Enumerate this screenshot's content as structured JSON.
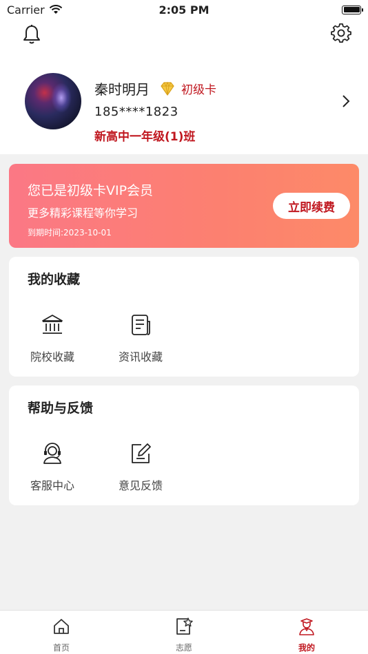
{
  "status_bar": {
    "carrier": "Carrier",
    "time": "2:05 PM"
  },
  "profile": {
    "name": "秦时明月",
    "card_level": "初级卡",
    "phone": "185****1823",
    "class_name": "新高中一年级(1)班"
  },
  "vip": {
    "title": "您已是初级卡VIP会员",
    "subtitle": "更多精彩课程等你学习",
    "expiry": "到期时间:2023-10-01",
    "renew_label": "立即续费"
  },
  "favorites": {
    "title": "我的收藏",
    "items": [
      {
        "label": "院校收藏",
        "icon": "building-icon"
      },
      {
        "label": "资讯收藏",
        "icon": "document-icon"
      }
    ]
  },
  "help": {
    "title": "帮助与反馈",
    "items": [
      {
        "label": "客服中心",
        "icon": "headset-icon"
      },
      {
        "label": "意见反馈",
        "icon": "edit-icon"
      }
    ]
  },
  "tabs": [
    {
      "label": "首页",
      "icon": "home-icon",
      "active": false
    },
    {
      "label": "志愿",
      "icon": "star-doc-icon",
      "active": false
    },
    {
      "label": "我的",
      "icon": "user-icon",
      "active": true
    }
  ],
  "colors": {
    "accent": "#c0171f",
    "vip_gradient_start": "#fb7885",
    "vip_gradient_end": "#fd8a68",
    "background": "#f1f1f1"
  }
}
